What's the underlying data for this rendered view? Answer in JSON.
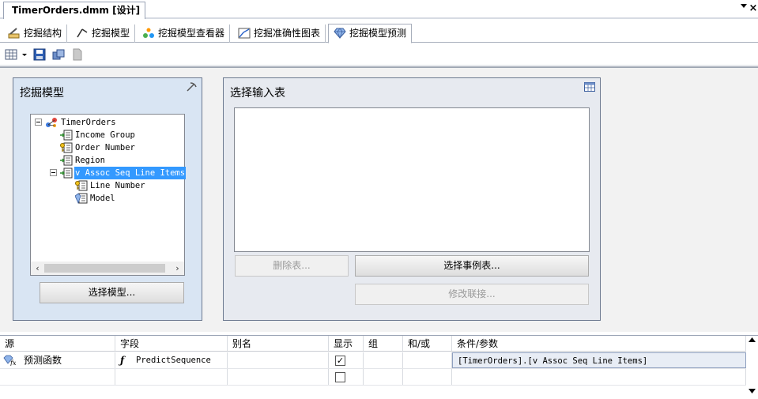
{
  "document": {
    "tab_title": "TimerOrders.dmm [设计]"
  },
  "designer_tabs": [
    {
      "label": "挖掘结构",
      "icon": "mining-structure-icon",
      "active": false
    },
    {
      "label": "挖掘模型",
      "icon": "mining-model-icon",
      "active": false
    },
    {
      "label": "挖掘模型查看器",
      "icon": "model-viewer-icon",
      "active": false
    },
    {
      "label": "挖掘准确性图表",
      "icon": "accuracy-chart-icon",
      "active": false
    },
    {
      "label": "挖掘模型预测",
      "icon": "prediction-gem-icon",
      "active": true
    }
  ],
  "toolbar": {
    "icons": [
      "grid-view-icon",
      "dropdown-arrow-icon",
      "save-icon",
      "copy-icon",
      "page-icon"
    ]
  },
  "mining_model_panel": {
    "title": "挖掘模型",
    "tree": [
      {
        "label": "TimerOrders",
        "icon": "model-root-icon",
        "expanded": true
      },
      {
        "label": "Income Group",
        "icon": "input-column-icon"
      },
      {
        "label": "Order Number",
        "icon": "key-column-icon"
      },
      {
        "label": "Region",
        "icon": "input-column-icon"
      },
      {
        "label": "v Assoc Seq Line Items",
        "icon": "nested-table-icon",
        "expanded": true,
        "selected": true
      },
      {
        "label": "Line Number",
        "icon": "key-column-icon"
      },
      {
        "label": "Model",
        "icon": "predict-column-icon"
      }
    ],
    "select_model_button": "选择模型..."
  },
  "input_table_panel": {
    "title": "选择输入表",
    "delete_table_button": "删除表...",
    "select_case_table_button": "选择事例表...",
    "modify_join_button": "修改联接..."
  },
  "grid": {
    "headers": [
      "源",
      "字段",
      "别名",
      "显示",
      "组",
      "和/或",
      "条件/参数"
    ],
    "rows": [
      {
        "source": "预测函数",
        "field": "PredictSequence",
        "alias": "",
        "show": true,
        "group": "",
        "andor": "",
        "criteria": "[TimerOrders].[v Assoc Seq Line Items]"
      },
      {
        "source": "",
        "field": "",
        "alias": "",
        "show": false,
        "group": "",
        "andor": "",
        "criteria": ""
      }
    ]
  },
  "colors": {
    "selection": "#3399ff",
    "panel_left_bg": "#d9e5f3",
    "panel_right_bg": "#e7eaf0"
  }
}
